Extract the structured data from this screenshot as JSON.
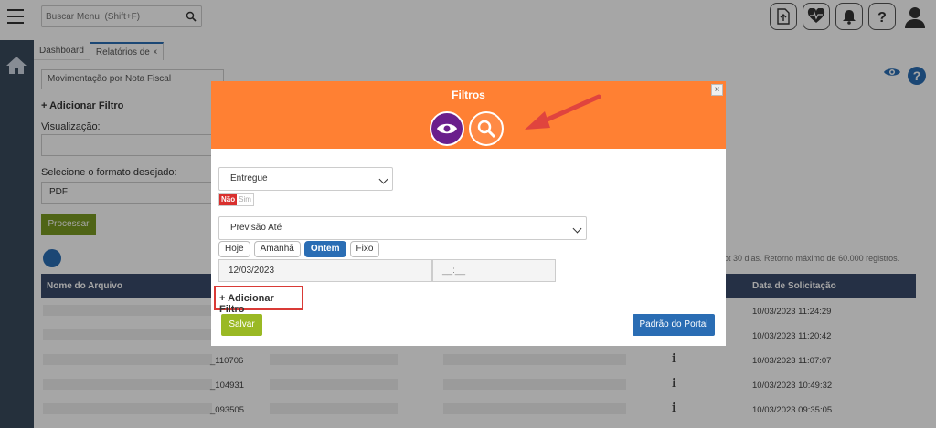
{
  "topbar": {
    "search_placeholder": "Buscar Menu  (Shift+F)",
    "icons": [
      "upload-icon",
      "heartbeat-icon",
      "bell-icon",
      "help-icon",
      "user-avatar-icon"
    ]
  },
  "tabs": [
    {
      "label": "Dashboard"
    },
    {
      "label": "Relatórios de",
      "close": "x"
    }
  ],
  "background": {
    "report_select": "Movimentação por Nota Fiscal",
    "add_filter": "+ Adicionar Filtro",
    "visualization_label": "Visualização:",
    "format_label": "Selecione o formato desejado:",
    "format_value": "PDF",
    "process_label": "Processar",
    "info_text": "ot 30 dias. Retorno máximo de 60.000 registros.",
    "table": {
      "headers": [
        "Nome do Arquivo",
        "Data de Solicitação"
      ],
      "rows": [
        {
          "file": "",
          "date": "10/03/2023 11:24:29"
        },
        {
          "file": "",
          "date": "10/03/2023 11:20:42"
        },
        {
          "file": "_110706",
          "date": "10/03/2023 11:07:07"
        },
        {
          "file": "_104931",
          "date": "10/03/2023 10:49:32"
        },
        {
          "file": "_093505",
          "date": "10/03/2023 09:35:05"
        }
      ]
    }
  },
  "modal": {
    "title": "Filtros",
    "close": "×",
    "status_select": "Entregue",
    "toggle_no": "Não",
    "toggle_yes": "Sim",
    "date_select": "Previsão Até",
    "chips": [
      "Hoje",
      "Amanhã",
      "Ontem",
      "Fixo"
    ],
    "active_chip": "Ontem",
    "date_value": "12/03/2023",
    "time_placeholder": "__:__",
    "add_filter": "+ Adicionar Filtro",
    "save": "Salvar",
    "portal_default": "Padrão do Portal"
  },
  "colors": {
    "modal_header": "#ff8033",
    "sidebar": "#3a4a5c",
    "primary": "#2a6db4",
    "highlight": "#d93a36",
    "save": "#9ab924"
  }
}
